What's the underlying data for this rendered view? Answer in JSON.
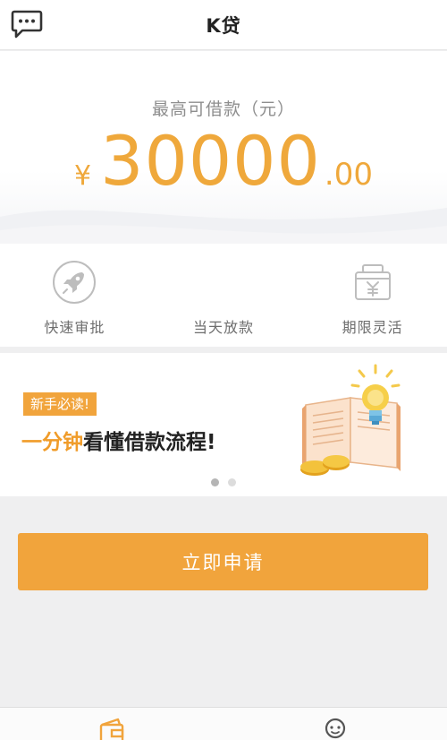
{
  "header": {
    "title": "K贷"
  },
  "hero": {
    "label": "最高可借款（元）",
    "currency_symbol": "¥",
    "amount_integer": "30000",
    "amount_decimal": ".00"
  },
  "features": [
    {
      "label": "快速审批",
      "icon": "rocket-icon"
    },
    {
      "label": "当天放款",
      "icon": ""
    },
    {
      "label": "期限灵活",
      "icon": "yen-case-icon"
    }
  ],
  "banner": {
    "tag": "新手必读!",
    "headline_highlight": "一分钟",
    "headline_rest": "看懂借款流程!",
    "slide_count": 2,
    "active_slide": 1
  },
  "apply_button": {
    "label": "立即申请"
  },
  "tabbar": {
    "tabs": [
      {
        "icon": "wallet-icon"
      },
      {
        "icon": "user-icon"
      }
    ]
  },
  "colors": {
    "accent": "#f1a43c",
    "accent_text": "#efa83b",
    "background": "#efeff0"
  }
}
